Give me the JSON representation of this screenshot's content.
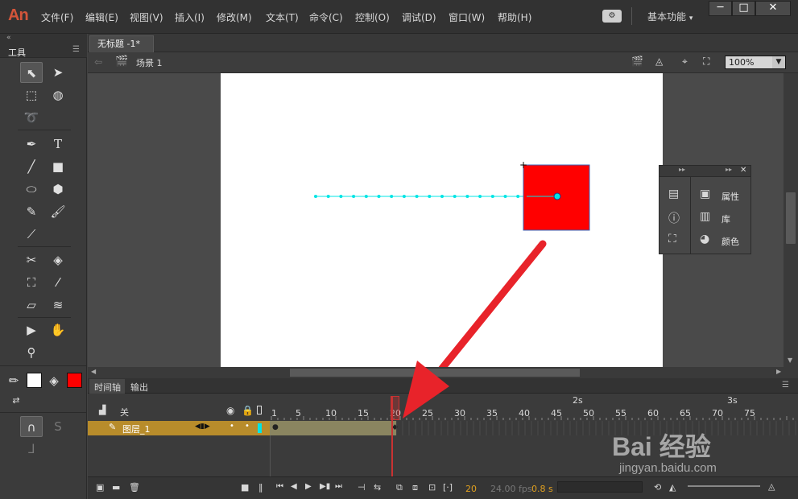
{
  "app": {
    "logo": "An"
  },
  "menu": [
    "文件(F)",
    "编辑(E)",
    "视图(V)",
    "插入(I)",
    "修改(M)",
    "文本(T)",
    "命令(C)",
    "控制(O)",
    "调试(D)",
    "窗口(W)",
    "帮助(H)"
  ],
  "workspace": {
    "label": "基本功能",
    "sync_icon": "sync-settings-icon"
  },
  "window_buttons": [
    "─",
    "□",
    "✕"
  ],
  "tools_panel": {
    "title": "工具"
  },
  "document": {
    "tab": "无标题 -1*",
    "tab_close": "×",
    "scene": "场景 1",
    "zoom": "100%"
  },
  "float_panel": {
    "items": [
      "属性",
      "库",
      "颜色"
    ]
  },
  "timeline": {
    "tabs": [
      "时间轴",
      "输出"
    ],
    "layer_header": "关",
    "layer_name": "图层_1",
    "frame_numbers": [
      "1",
      "5",
      "10",
      "15",
      "20",
      "25",
      "30",
      "35",
      "40",
      "45",
      "50",
      "55",
      "60",
      "65",
      "70",
      "75"
    ],
    "seconds": [
      "2s",
      "3s"
    ],
    "current_frame": "20",
    "fps": "24.00 fps",
    "elapsed": "0.8 s"
  },
  "watermark": {
    "brand": "Bai 经验",
    "url": "jingyan.baidu.com"
  },
  "colors": {
    "stroke": "#ffffff",
    "fill": "#ff0000",
    "shape": "#ff0000",
    "motion_path": "#00e5e5"
  }
}
